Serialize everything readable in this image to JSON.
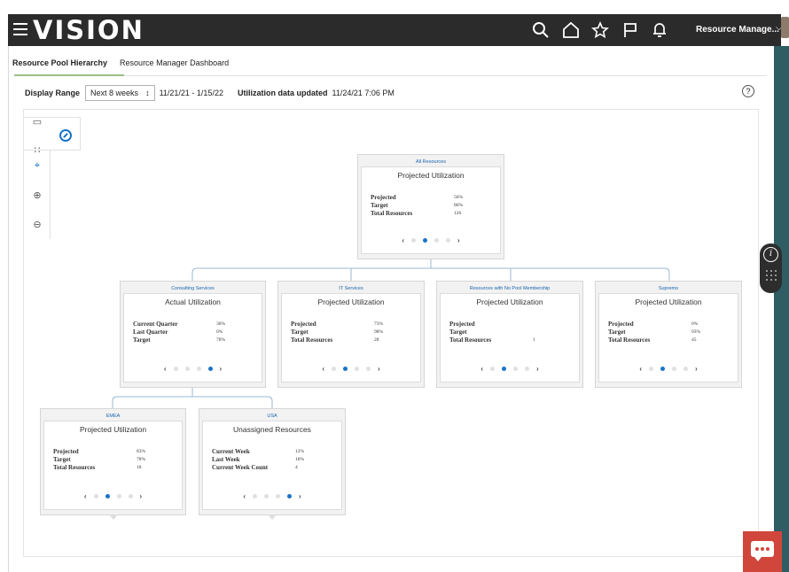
{
  "header": {
    "logo": "VISION",
    "user_name": "Resource Manage...",
    "icons": [
      "menu-icon",
      "search-icon",
      "home-icon",
      "star-icon",
      "flag-icon",
      "bell-icon",
      "chevron-down-icon"
    ]
  },
  "tabs": [
    {
      "label": "Resource Pool Hierarchy",
      "active": true
    },
    {
      "label": "Resource Manager Dashboard",
      "active": false
    }
  ],
  "filters": {
    "display_range_label": "Display Range",
    "display_range_value": "Next 8 weeks",
    "date_range": "11/21/21 - 1/15/22",
    "updated_label": "Utilization data updated",
    "updated_value": "11/24/21 7:06 PM"
  },
  "nodes": {
    "all": {
      "title": "All Resources",
      "subtitle": "Projected Utilization",
      "rows": [
        {
          "k": "Projected",
          "v": "56%"
        },
        {
          "k": "Target",
          "v": "86%"
        },
        {
          "k": "Total Resources",
          "v": "126"
        }
      ],
      "active_page": 1
    },
    "consulting": {
      "title": "Consulting Services",
      "subtitle": "Actual Utilization",
      "rows": [
        {
          "k": "Current Quarter",
          "v": "30%"
        },
        {
          "k": "Last Quarter",
          "v": "0%"
        },
        {
          "k": "Target",
          "v": "78%"
        }
      ],
      "active_page": 3
    },
    "it": {
      "title": "IT Services",
      "subtitle": "Projected Utilization",
      "rows": [
        {
          "k": "Projected",
          "v": "73%"
        },
        {
          "k": "Target",
          "v": "98%"
        },
        {
          "k": "Total Resources",
          "v": "28"
        }
      ],
      "active_page": 1
    },
    "nopool": {
      "title": "Resources with No Pool Membership",
      "subtitle": "Projected Utilization",
      "rows": [
        {
          "k": "Projected",
          "v": ""
        },
        {
          "k": "Target",
          "v": ""
        },
        {
          "k": "Total Resources",
          "v": "1"
        }
      ],
      "active_page": 1
    },
    "supremo": {
      "title": "Supremo",
      "subtitle": "Projected Utilization",
      "rows": [
        {
          "k": "Projected",
          "v": "0%"
        },
        {
          "k": "Target",
          "v": "93%"
        },
        {
          "k": "Total Resources",
          "v": "45"
        }
      ],
      "active_page": 1
    },
    "emea": {
      "title": "EMEA",
      "subtitle": "Projected Utilization",
      "rows": [
        {
          "k": "Projected",
          "v": "83%"
        },
        {
          "k": "Target",
          "v": "78%"
        },
        {
          "k": "Total Resources",
          "v": "18"
        }
      ],
      "active_page": 1
    },
    "usa": {
      "title": "USA",
      "subtitle": "Unassigned Resources",
      "rows": [
        {
          "k": "Current Week",
          "v": "12%"
        },
        {
          "k": "Last Week",
          "v": "18%"
        },
        {
          "k": "Current Week Count",
          "v": "4"
        }
      ],
      "active_page": 3
    }
  },
  "colors": {
    "accent": "#1a73c8",
    "header_bg": "#2b2b2b",
    "chat": "#d1463b",
    "teal": "#2e5e63"
  }
}
